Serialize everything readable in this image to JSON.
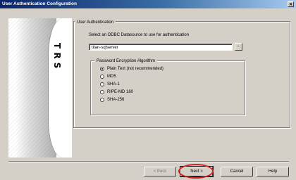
{
  "window": {
    "title": "User Authentication Configuration",
    "close_glyph": "✕"
  },
  "banner": {
    "letters": [
      "T",
      "R",
      "S"
    ]
  },
  "auth_group": {
    "title": "User Authentication",
    "instruction": "Select an ODBC Datasource to use for authentication",
    "datasource_value": "titan-sqlserver",
    "browse_label": "..."
  },
  "pw_group": {
    "title": "Password Encryption Algorithm",
    "options": [
      "Plain Text (not recommended)",
      "MD5",
      "SHA-1",
      "RIPE-MD 160",
      "SHA-256"
    ],
    "selected": "Plain Text (not recommended)"
  },
  "buttons": {
    "back": "< Back",
    "next": "Next >",
    "cancel": "Cancel",
    "help": "Help"
  },
  "colors": {
    "title_start": "#0a246a",
    "title_end": "#a6caf0",
    "highlight": "#d42020",
    "face": "#d4d0c8"
  }
}
